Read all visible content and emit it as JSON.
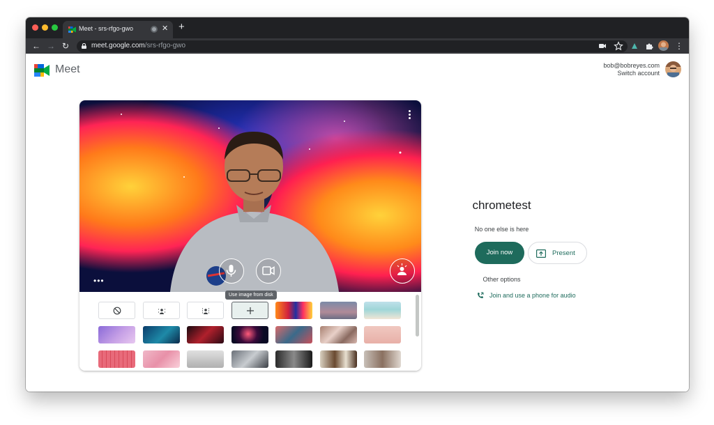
{
  "browser": {
    "tab_title": "Meet - srs-rfgo-gwo",
    "url_host": "meet.google.com",
    "url_path": "/srs-rfgo-gwo"
  },
  "header": {
    "app_name": "Meet",
    "account_email": "bob@bobreyes.com",
    "switch_account": "Switch account"
  },
  "preview": {
    "tooltip": "Use image from disk"
  },
  "backgrounds": {
    "options": [
      "no-effect",
      "slight-blur",
      "blur",
      "add-image"
    ],
    "images": [
      "galaxy",
      "dusk",
      "beach",
      "purple-sky",
      "aurora",
      "red-nebula",
      "fireworks",
      "blossoms",
      "pebbles",
      "pink",
      "pink-grid",
      "cherry",
      "white-room",
      "loft",
      "dark-room",
      "bookshelf",
      "office"
    ]
  },
  "join_panel": {
    "room_name": "chrometest",
    "status": "No one else is here",
    "join_label": "Join now",
    "present_label": "Present",
    "other_options": "Other options",
    "phone_label": "Join and use a phone for audio"
  },
  "colors": {
    "primary": "#1e6b5c",
    "chrome_dark": "#202124",
    "chrome_toolbar": "#35363a"
  }
}
